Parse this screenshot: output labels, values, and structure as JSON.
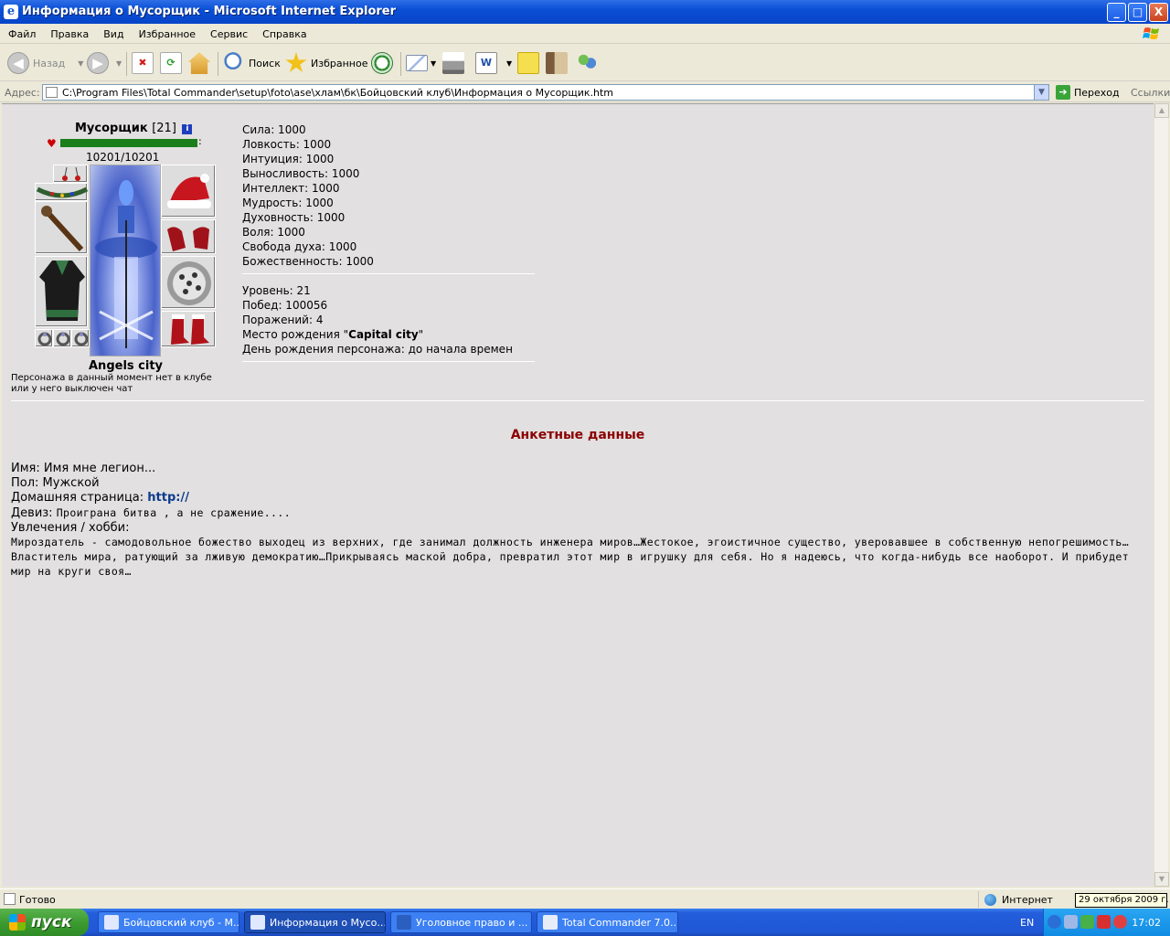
{
  "window": {
    "title": "Информация о Мусорщик - Microsoft Internet Explorer",
    "buttons": {
      "minimize": "_",
      "maximize": "□",
      "close": "X"
    }
  },
  "menu": [
    "Файл",
    "Правка",
    "Вид",
    "Избранное",
    "Сервис",
    "Справка"
  ],
  "toolbar": {
    "back": "Назад",
    "search": "Поиск",
    "favorites": "Избранное"
  },
  "address": {
    "label": "Адрес:",
    "url": "C:\\Program Files\\Total Commander\\setup\\foto\\ase\\хлам\\бк\\Бойцовский клуб\\Информация о Мусорщик.htm",
    "go": "Переход",
    "links": "Ссылки"
  },
  "character": {
    "name": "Мусорщик",
    "level_tag": "[21]",
    "hp_text": "10201/10201",
    "hp_fraction": 1.0,
    "city": "Angels city",
    "offline_note_1": "Персонажа в данный момент нет в клубе",
    "offline_note_2": "или у него выключен чат"
  },
  "stats": [
    "Сила: 1000",
    "Ловкость: 1000",
    "Интуиция: 1000",
    "Выносливость: 1000",
    "Интеллект: 1000",
    "Мудрость: 1000",
    "Духовность: 1000",
    "Воля: 1000",
    "Свобода духа: 1000",
    "Божественность: 1000"
  ],
  "record": {
    "level": "Уровень: 21",
    "wins": "Побед: 100056",
    "losses": "Поражений: 4",
    "birthplace_prefix": "Место рождения \"",
    "birthplace_value": "Capital city",
    "birthplace_suffix": "\"",
    "birthday": "День рождения персонажа: до начала времен"
  },
  "anketa": {
    "title": "Анкетные данные",
    "name": "Имя: Имя мне легион...",
    "gender": "Пол: Мужской",
    "homepage_label": "Домашняя страница:",
    "homepage_link": "http://",
    "motto_label": "Девиз:",
    "motto_value": "Проиграна битва , а не сражение....",
    "hobby_label": "Увлечения / хобби:",
    "hobby_text": "Мироздатель - самодовольное божество выходец из верхних, где занимал должность инженера миров…Жестокое, эгоистичное существо, уверовавшее в собственную непогрешимость…Властитель мира, ратующий за лживую демократию…Прикрываясь маской добра, превратил этот мир в игрушку для себя. Но я надеюсь, что когда-нибудь все наоборот. И прибудет мир на круги своя…"
  },
  "status": {
    "text": "Готово",
    "zone": "Интернет",
    "tooltip": "29 октября 2009 г."
  },
  "taskbar": {
    "start": "пуск",
    "tasks": [
      "Бойцовский клуб - M...",
      "Информация о Мусо...",
      "Уголовное право и ...",
      "Total Commander 7.0..."
    ],
    "lang": "EN",
    "clock": "17:02"
  }
}
